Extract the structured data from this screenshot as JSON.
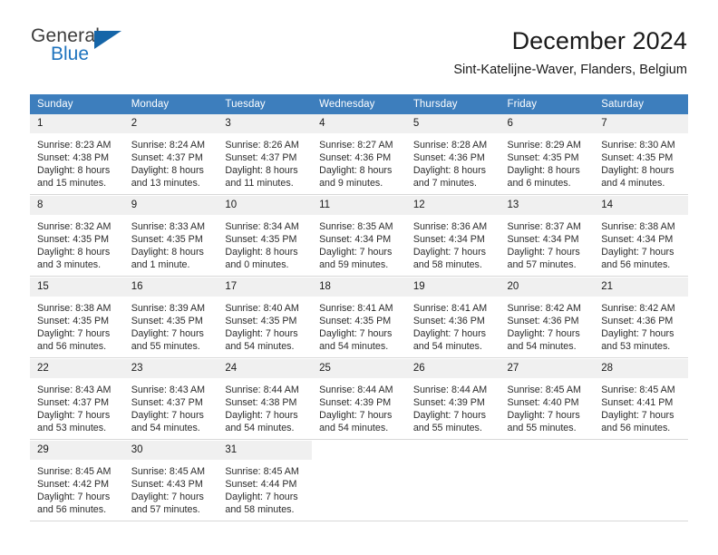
{
  "brand": {
    "name_top": "General",
    "name_bottom": "Blue",
    "flag_icon": "triangle-flag-icon",
    "accent_color": "#1565a8",
    "blue_text_color": "#1e73be"
  },
  "header": {
    "title": "December 2024",
    "subtitle": "Sint-Katelijne-Waver, Flanders, Belgium"
  },
  "calendar": {
    "header_bg": "#3d7ebd",
    "daynum_bg": "#f0f0f0",
    "weekday_headers": [
      "Sunday",
      "Monday",
      "Tuesday",
      "Wednesday",
      "Thursday",
      "Friday",
      "Saturday"
    ],
    "weeks": [
      [
        {
          "day": "1",
          "sunrise": "Sunrise: 8:23 AM",
          "sunset": "Sunset: 4:38 PM",
          "daylight_line1": "Daylight: 8 hours",
          "daylight_line2": "and 15 minutes."
        },
        {
          "day": "2",
          "sunrise": "Sunrise: 8:24 AM",
          "sunset": "Sunset: 4:37 PM",
          "daylight_line1": "Daylight: 8 hours",
          "daylight_line2": "and 13 minutes."
        },
        {
          "day": "3",
          "sunrise": "Sunrise: 8:26 AM",
          "sunset": "Sunset: 4:37 PM",
          "daylight_line1": "Daylight: 8 hours",
          "daylight_line2": "and 11 minutes."
        },
        {
          "day": "4",
          "sunrise": "Sunrise: 8:27 AM",
          "sunset": "Sunset: 4:36 PM",
          "daylight_line1": "Daylight: 8 hours",
          "daylight_line2": "and 9 minutes."
        },
        {
          "day": "5",
          "sunrise": "Sunrise: 8:28 AM",
          "sunset": "Sunset: 4:36 PM",
          "daylight_line1": "Daylight: 8 hours",
          "daylight_line2": "and 7 minutes."
        },
        {
          "day": "6",
          "sunrise": "Sunrise: 8:29 AM",
          "sunset": "Sunset: 4:35 PM",
          "daylight_line1": "Daylight: 8 hours",
          "daylight_line2": "and 6 minutes."
        },
        {
          "day": "7",
          "sunrise": "Sunrise: 8:30 AM",
          "sunset": "Sunset: 4:35 PM",
          "daylight_line1": "Daylight: 8 hours",
          "daylight_line2": "and 4 minutes."
        }
      ],
      [
        {
          "day": "8",
          "sunrise": "Sunrise: 8:32 AM",
          "sunset": "Sunset: 4:35 PM",
          "daylight_line1": "Daylight: 8 hours",
          "daylight_line2": "and 3 minutes."
        },
        {
          "day": "9",
          "sunrise": "Sunrise: 8:33 AM",
          "sunset": "Sunset: 4:35 PM",
          "daylight_line1": "Daylight: 8 hours",
          "daylight_line2": "and 1 minute."
        },
        {
          "day": "10",
          "sunrise": "Sunrise: 8:34 AM",
          "sunset": "Sunset: 4:35 PM",
          "daylight_line1": "Daylight: 8 hours",
          "daylight_line2": "and 0 minutes."
        },
        {
          "day": "11",
          "sunrise": "Sunrise: 8:35 AM",
          "sunset": "Sunset: 4:34 PM",
          "daylight_line1": "Daylight: 7 hours",
          "daylight_line2": "and 59 minutes."
        },
        {
          "day": "12",
          "sunrise": "Sunrise: 8:36 AM",
          "sunset": "Sunset: 4:34 PM",
          "daylight_line1": "Daylight: 7 hours",
          "daylight_line2": "and 58 minutes."
        },
        {
          "day": "13",
          "sunrise": "Sunrise: 8:37 AM",
          "sunset": "Sunset: 4:34 PM",
          "daylight_line1": "Daylight: 7 hours",
          "daylight_line2": "and 57 minutes."
        },
        {
          "day": "14",
          "sunrise": "Sunrise: 8:38 AM",
          "sunset": "Sunset: 4:34 PM",
          "daylight_line1": "Daylight: 7 hours",
          "daylight_line2": "and 56 minutes."
        }
      ],
      [
        {
          "day": "15",
          "sunrise": "Sunrise: 8:38 AM",
          "sunset": "Sunset: 4:35 PM",
          "daylight_line1": "Daylight: 7 hours",
          "daylight_line2": "and 56 minutes."
        },
        {
          "day": "16",
          "sunrise": "Sunrise: 8:39 AM",
          "sunset": "Sunset: 4:35 PM",
          "daylight_line1": "Daylight: 7 hours",
          "daylight_line2": "and 55 minutes."
        },
        {
          "day": "17",
          "sunrise": "Sunrise: 8:40 AM",
          "sunset": "Sunset: 4:35 PM",
          "daylight_line1": "Daylight: 7 hours",
          "daylight_line2": "and 54 minutes."
        },
        {
          "day": "18",
          "sunrise": "Sunrise: 8:41 AM",
          "sunset": "Sunset: 4:35 PM",
          "daylight_line1": "Daylight: 7 hours",
          "daylight_line2": "and 54 minutes."
        },
        {
          "day": "19",
          "sunrise": "Sunrise: 8:41 AM",
          "sunset": "Sunset: 4:36 PM",
          "daylight_line1": "Daylight: 7 hours",
          "daylight_line2": "and 54 minutes."
        },
        {
          "day": "20",
          "sunrise": "Sunrise: 8:42 AM",
          "sunset": "Sunset: 4:36 PM",
          "daylight_line1": "Daylight: 7 hours",
          "daylight_line2": "and 54 minutes."
        },
        {
          "day": "21",
          "sunrise": "Sunrise: 8:42 AM",
          "sunset": "Sunset: 4:36 PM",
          "daylight_line1": "Daylight: 7 hours",
          "daylight_line2": "and 53 minutes."
        }
      ],
      [
        {
          "day": "22",
          "sunrise": "Sunrise: 8:43 AM",
          "sunset": "Sunset: 4:37 PM",
          "daylight_line1": "Daylight: 7 hours",
          "daylight_line2": "and 53 minutes."
        },
        {
          "day": "23",
          "sunrise": "Sunrise: 8:43 AM",
          "sunset": "Sunset: 4:37 PM",
          "daylight_line1": "Daylight: 7 hours",
          "daylight_line2": "and 54 minutes."
        },
        {
          "day": "24",
          "sunrise": "Sunrise: 8:44 AM",
          "sunset": "Sunset: 4:38 PM",
          "daylight_line1": "Daylight: 7 hours",
          "daylight_line2": "and 54 minutes."
        },
        {
          "day": "25",
          "sunrise": "Sunrise: 8:44 AM",
          "sunset": "Sunset: 4:39 PM",
          "daylight_line1": "Daylight: 7 hours",
          "daylight_line2": "and 54 minutes."
        },
        {
          "day": "26",
          "sunrise": "Sunrise: 8:44 AM",
          "sunset": "Sunset: 4:39 PM",
          "daylight_line1": "Daylight: 7 hours",
          "daylight_line2": "and 55 minutes."
        },
        {
          "day": "27",
          "sunrise": "Sunrise: 8:45 AM",
          "sunset": "Sunset: 4:40 PM",
          "daylight_line1": "Daylight: 7 hours",
          "daylight_line2": "and 55 minutes."
        },
        {
          "day": "28",
          "sunrise": "Sunrise: 8:45 AM",
          "sunset": "Sunset: 4:41 PM",
          "daylight_line1": "Daylight: 7 hours",
          "daylight_line2": "and 56 minutes."
        }
      ],
      [
        {
          "day": "29",
          "sunrise": "Sunrise: 8:45 AM",
          "sunset": "Sunset: 4:42 PM",
          "daylight_line1": "Daylight: 7 hours",
          "daylight_line2": "and 56 minutes."
        },
        {
          "day": "30",
          "sunrise": "Sunrise: 8:45 AM",
          "sunset": "Sunset: 4:43 PM",
          "daylight_line1": "Daylight: 7 hours",
          "daylight_line2": "and 57 minutes."
        },
        {
          "day": "31",
          "sunrise": "Sunrise: 8:45 AM",
          "sunset": "Sunset: 4:44 PM",
          "daylight_line1": "Daylight: 7 hours",
          "daylight_line2": "and 58 minutes."
        },
        {
          "day": "",
          "sunrise": "",
          "sunset": "",
          "daylight_line1": "",
          "daylight_line2": ""
        },
        {
          "day": "",
          "sunrise": "",
          "sunset": "",
          "daylight_line1": "",
          "daylight_line2": ""
        },
        {
          "day": "",
          "sunrise": "",
          "sunset": "",
          "daylight_line1": "",
          "daylight_line2": ""
        },
        {
          "day": "",
          "sunrise": "",
          "sunset": "",
          "daylight_line1": "",
          "daylight_line2": ""
        }
      ]
    ]
  }
}
